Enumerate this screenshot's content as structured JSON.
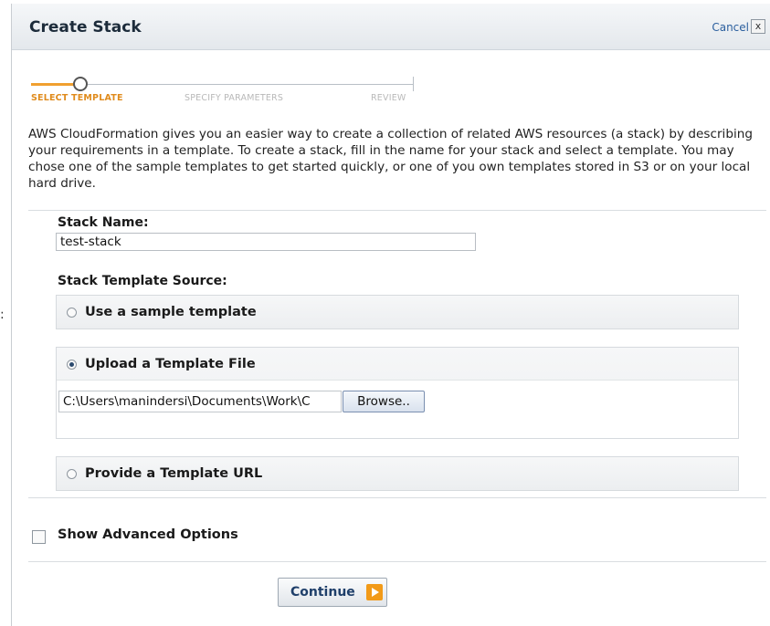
{
  "dialog": {
    "title": "Create Stack",
    "cancel_label": "Cancel",
    "close_glyph": "x"
  },
  "wizard": {
    "steps": [
      "SELECT TEMPLATE",
      "SPECIFY PARAMETERS",
      "REVIEW"
    ],
    "active_step": "SELECT TEMPLATE"
  },
  "description": "AWS CloudFormation gives you an easier way to create a collection of related AWS resources (a stack) by describing your requirements in a template. To create a stack, fill in the name for your stack and select a template. You may chose one of the sample templates to get started quickly, or one of you own templates stored in S3 or on your local hard drive.",
  "stack_name": {
    "label": "Stack Name:",
    "value": "test-stack"
  },
  "template_source": {
    "label": "Stack Template Source:",
    "options": [
      {
        "label": "Use a sample template",
        "selected": false
      },
      {
        "label": "Upload a Template File",
        "selected": true
      },
      {
        "label": "Provide a Template URL",
        "selected": false
      }
    ],
    "file_path": "C:\\Users\\manindersi\\Documents\\Work\\C",
    "browse_label": "Browse.."
  },
  "advanced": {
    "label": "Show Advanced Options",
    "checked": false
  },
  "continue_label": "Continue",
  "stray_text": ":",
  "colors": {
    "accent": "#f29a18",
    "step_active": "#e08b1c",
    "link": "#2b5f9e"
  }
}
